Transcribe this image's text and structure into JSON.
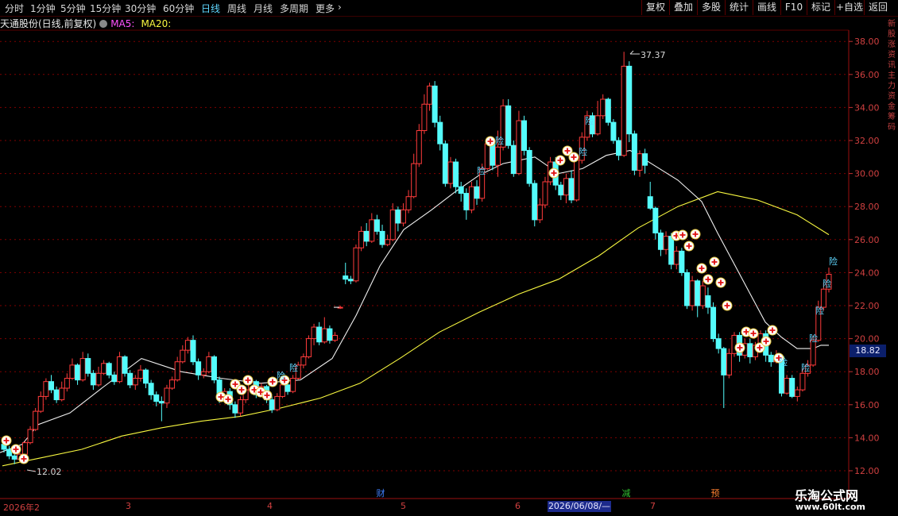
{
  "toolbar": {
    "periods": [
      "分时",
      "1分钟",
      "5分钟",
      "15分钟",
      "30分钟",
      "60分钟",
      "日线",
      "周线",
      "月线",
      "多周期",
      "更多"
    ],
    "active_period": "日线",
    "more_chevron": "›",
    "buttons": [
      "复权",
      "叠加",
      "多股",
      "统计",
      "画线",
      "F10",
      "标记",
      "+自选",
      "返回"
    ]
  },
  "stock": {
    "title": "天通股份(日线,前复权)",
    "ma5_label": "MA5:",
    "ma20_label": "MA20:"
  },
  "colors": {
    "up": "#ff3b3b",
    "down": "#54fcfc",
    "ma5": "#f0f0f0",
    "ma20": "#f8f840",
    "grid": "#800000",
    "axis_text": "#d04040"
  },
  "price_axis": {
    "ticks": [
      "38.00",
      "36.00",
      "34.00",
      "32.00",
      "30.00",
      "28.00",
      "26.00",
      "24.00",
      "22.00",
      "20.00",
      "18.00",
      "16.00",
      "14.00",
      "12.00"
    ]
  },
  "current_price": "18.82",
  "annotations": {
    "high": "37.37",
    "low": "12.02"
  },
  "sidebar_text": "新股涨资讯主力资金筹码",
  "x_axis": {
    "labels": [
      "2026年2",
      "3",
      "4",
      "5",
      "6",
      "7"
    ],
    "cursor_date": "2026/06/08/—"
  },
  "events": {
    "cai": "财",
    "jian": "减",
    "yu": "预"
  },
  "markers": {
    "xian": "险"
  },
  "watermark": {
    "title": "乐淘公式网",
    "url": "www.60lt.com"
  },
  "chart_data": {
    "type": "candlestick",
    "ylim": [
      12,
      38
    ],
    "high_label": 37.37,
    "low_label": 12.02,
    "last": 18.82,
    "candles": [
      [
        13.6,
        13.3,
        13.9,
        13.1
      ],
      [
        13.3,
        12.9,
        13.5,
        12.7
      ],
      [
        12.9,
        12.7,
        13.1,
        12.4
      ],
      [
        12.7,
        13.0,
        13.2,
        12.5
      ],
      [
        13.0,
        13.7,
        13.8,
        12.9
      ],
      [
        13.7,
        14.5,
        14.7,
        13.6
      ],
      [
        14.5,
        15.6,
        15.8,
        14.4
      ],
      [
        15.6,
        16.5,
        16.8,
        15.5
      ],
      [
        16.5,
        17.4,
        17.6,
        16.3
      ],
      [
        17.4,
        16.9,
        17.8,
        16.7
      ],
      [
        16.9,
        16.3,
        17.1,
        16.1
      ],
      [
        16.3,
        17.0,
        17.4,
        16.2
      ],
      [
        17.0,
        17.6,
        17.9,
        16.8
      ],
      [
        17.6,
        18.4,
        18.8,
        17.5
      ],
      [
        18.4,
        17.5,
        18.5,
        17.2
      ],
      [
        17.5,
        18.8,
        19.2,
        17.4
      ],
      [
        18.8,
        17.9,
        19.1,
        17.7
      ],
      [
        17.9,
        17.2,
        18.1,
        16.9
      ],
      [
        17.2,
        17.9,
        18.3,
        17.1
      ],
      [
        17.9,
        18.5,
        18.7,
        17.8
      ],
      [
        18.5,
        17.8,
        18.6,
        17.6
      ],
      [
        17.8,
        17.4,
        18.0,
        17.2
      ],
      [
        17.4,
        18.9,
        19.2,
        17.3
      ],
      [
        18.9,
        17.9,
        19.0,
        17.7
      ],
      [
        17.9,
        17.2,
        18.1,
        17.0
      ],
      [
        17.2,
        17.6,
        17.8,
        16.9
      ],
      [
        17.6,
        18.1,
        18.4,
        17.4
      ],
      [
        18.1,
        17.3,
        18.2,
        17.0
      ],
      [
        17.3,
        16.6,
        17.5,
        16.3
      ],
      [
        16.6,
        16.2,
        16.8,
        15.9
      ],
      [
        16.2,
        16.1,
        16.5,
        15.0
      ],
      [
        16.1,
        17.0,
        17.2,
        15.8
      ],
      [
        17.0,
        17.5,
        17.7,
        16.9
      ],
      [
        17.5,
        18.6,
        18.9,
        17.4
      ],
      [
        18.6,
        19.3,
        19.6,
        18.5
      ],
      [
        19.3,
        19.9,
        20.1,
        19.1
      ],
      [
        19.9,
        18.6,
        20.2,
        18.4
      ],
      [
        18.6,
        17.8,
        18.8,
        17.5
      ],
      [
        17.8,
        18.0,
        18.2,
        17.6
      ],
      [
        18.0,
        18.9,
        19.2,
        17.9
      ],
      [
        18.9,
        17.5,
        19.0,
        17.3
      ],
      [
        17.5,
        16.4,
        17.7,
        16.1
      ],
      [
        16.4,
        16.8,
        17.0,
        16.2
      ],
      [
        16.8,
        16.0,
        17.0,
        15.7
      ],
      [
        16.0,
        15.5,
        16.2,
        15.2
      ],
      [
        15.5,
        16.3,
        16.5,
        15.3
      ],
      [
        16.3,
        16.9,
        17.1,
        16.1
      ],
      [
        16.9,
        17.4,
        17.6,
        16.7
      ],
      [
        17.4,
        16.6,
        17.5,
        16.4
      ],
      [
        16.6,
        17.1,
        17.3,
        16.5
      ],
      [
        17.1,
        16.3,
        17.2,
        16.1
      ],
      [
        16.3,
        15.7,
        16.5,
        15.5
      ],
      [
        15.7,
        16.5,
        16.7,
        15.6
      ],
      [
        16.5,
        17.2,
        17.4,
        16.4
      ],
      [
        17.2,
        16.8,
        17.5,
        16.6
      ],
      [
        16.8,
        17.6,
        17.8,
        16.7
      ],
      [
        17.6,
        18.4,
        18.6,
        17.5
      ],
      [
        18.4,
        18.9,
        19.1,
        18.2
      ],
      [
        18.9,
        20.0,
        20.2,
        18.8
      ],
      [
        20.0,
        20.7,
        20.9,
        19.6
      ],
      [
        20.7,
        19.8,
        21.0,
        19.6
      ],
      [
        19.8,
        20.6,
        21.3,
        19.7
      ],
      [
        20.6,
        19.9,
        20.8,
        19.7
      ],
      [
        19.9,
        20.2,
        20.4,
        19.8
      ],
      [
        21.9,
        21.9,
        22.0,
        21.8
      ],
      [
        23.8,
        23.6,
        24.6,
        23.3
      ],
      [
        23.6,
        23.5,
        23.8,
        23.3
      ],
      [
        23.5,
        25.5,
        25.7,
        23.4
      ],
      [
        25.5,
        26.5,
        26.8,
        25.3
      ],
      [
        26.5,
        25.9,
        27.0,
        25.6
      ],
      [
        25.9,
        27.2,
        27.6,
        25.8
      ],
      [
        27.2,
        26.5,
        27.5,
        26.3
      ],
      [
        26.5,
        25.7,
        26.9,
        25.5
      ],
      [
        25.7,
        26.0,
        26.3,
        25.6
      ],
      [
        26.0,
        27.8,
        28.2,
        25.9
      ],
      [
        27.8,
        27.0,
        28.0,
        26.5
      ],
      [
        27.0,
        27.8,
        28.2,
        26.8
      ],
      [
        27.8,
        28.6,
        29.0,
        27.6
      ],
      [
        28.6,
        30.6,
        31.2,
        28.5
      ],
      [
        30.6,
        32.6,
        33.0,
        30.4
      ],
      [
        32.6,
        34.2,
        34.8,
        32.4
      ],
      [
        34.2,
        35.3,
        35.5,
        33.8
      ],
      [
        35.3,
        33.1,
        35.6,
        32.8
      ],
      [
        33.1,
        31.8,
        33.5,
        31.4
      ],
      [
        31.8,
        29.4,
        32.0,
        29.2
      ],
      [
        29.4,
        30.7,
        31.0,
        29.1
      ],
      [
        30.7,
        29.2,
        30.9,
        28.8
      ],
      [
        29.2,
        28.8,
        29.5,
        28.3
      ],
      [
        28.8,
        27.8,
        29.1,
        27.2
      ],
      [
        27.8,
        29.2,
        29.5,
        27.6
      ],
      [
        29.2,
        28.5,
        29.6,
        28.1
      ],
      [
        28.5,
        30.3,
        30.6,
        28.3
      ],
      [
        30.3,
        31.8,
        32.2,
        30.2
      ],
      [
        31.8,
        30.5,
        32.0,
        30.2
      ],
      [
        30.5,
        31.6,
        32.6,
        29.8
      ],
      [
        31.6,
        34.1,
        34.5,
        31.4
      ],
      [
        34.1,
        31.7,
        34.5,
        31.5
      ],
      [
        31.7,
        30.0,
        32.0,
        29.8
      ],
      [
        30.0,
        33.2,
        33.8,
        29.9
      ],
      [
        33.2,
        31.4,
        33.5,
        31.1
      ],
      [
        31.4,
        29.4,
        31.6,
        29.2
      ],
      [
        29.4,
        27.2,
        29.6,
        26.8
      ],
      [
        27.2,
        28.1,
        28.5,
        27.0
      ],
      [
        28.1,
        29.5,
        29.8,
        27.9
      ],
      [
        29.5,
        30.7,
        31.0,
        29.3
      ],
      [
        30.7,
        29.3,
        31.0,
        29.0
      ],
      [
        29.3,
        28.7,
        29.5,
        28.4
      ],
      [
        28.7,
        29.7,
        30.0,
        28.2
      ],
      [
        29.7,
        28.4,
        30.2,
        28.2
      ],
      [
        28.4,
        30.8,
        31.2,
        28.3
      ],
      [
        30.8,
        32.2,
        32.5,
        30.6
      ],
      [
        32.2,
        33.5,
        33.8,
        32.0
      ],
      [
        33.5,
        32.4,
        33.7,
        32.2
      ],
      [
        32.4,
        33.5,
        34.4,
        32.3
      ],
      [
        33.5,
        34.5,
        34.8,
        33.3
      ],
      [
        34.5,
        33.1,
        34.6,
        32.9
      ],
      [
        33.1,
        32.0,
        33.3,
        31.8
      ],
      [
        32.0,
        31.1,
        32.2,
        30.8
      ],
      [
        31.1,
        36.5,
        37.37,
        31.0
      ],
      [
        36.5,
        32.4,
        36.8,
        31.9
      ],
      [
        32.4,
        30.2,
        32.6,
        29.9
      ],
      [
        30.2,
        31.2,
        31.4,
        29.8
      ],
      [
        31.2,
        30.5,
        31.5,
        30.0
      ],
      [
        28.6,
        27.9,
        29.5,
        27.8
      ],
      [
        27.9,
        26.4,
        28.0,
        26.0
      ],
      [
        26.4,
        25.4,
        26.6,
        25.0
      ],
      [
        25.4,
        26.2,
        26.5,
        25.1
      ],
      [
        26.2,
        24.5,
        26.4,
        24.2
      ],
      [
        24.5,
        25.3,
        25.6,
        24.2
      ],
      [
        25.3,
        24.0,
        25.5,
        23.8
      ],
      [
        24.0,
        22.0,
        24.2,
        21.8
      ],
      [
        22.0,
        23.5,
        23.8,
        21.7
      ],
      [
        23.5,
        22.0,
        23.6,
        21.3
      ],
      [
        22.0,
        23.2,
        23.5,
        21.8
      ],
      [
        22.6,
        21.9,
        23.1,
        21.5
      ],
      [
        21.9,
        20.0,
        22.2,
        19.8
      ],
      [
        20.0,
        19.4,
        20.3,
        19.1
      ],
      [
        19.4,
        17.8,
        19.5,
        15.8
      ],
      [
        17.8,
        19.1,
        19.4,
        17.6
      ],
      [
        19.1,
        20.2,
        20.4,
        18.9
      ],
      [
        20.2,
        19.0,
        20.4,
        18.6
      ],
      [
        19.0,
        19.7,
        20.0,
        18.8
      ],
      [
        19.7,
        18.9,
        20.0,
        18.5
      ],
      [
        18.9,
        19.6,
        19.8,
        18.7
      ],
      [
        19.6,
        20.3,
        20.5,
        19.4
      ],
      [
        20.3,
        19.0,
        20.5,
        18.6
      ],
      [
        19.0,
        18.6,
        19.2,
        18.3
      ],
      [
        18.6,
        18.9,
        19.3,
        18.5
      ],
      [
        18.9,
        16.7,
        19.0,
        16.5
      ],
      [
        16.7,
        17.6,
        17.8,
        16.6
      ],
      [
        17.6,
        16.5,
        17.8,
        16.4
      ],
      [
        16.5,
        16.9,
        17.1,
        16.2
      ],
      [
        16.9,
        17.9,
        18.2,
        16.8
      ],
      [
        17.9,
        18.4,
        18.7,
        17.7
      ],
      [
        18.4,
        19.9,
        20.2,
        18.3
      ],
      [
        19.9,
        21.9,
        22.3,
        19.8
      ],
      [
        21.9,
        23.0,
        23.4,
        21.7
      ],
      [
        23.0,
        23.9,
        24.3,
        22.8
      ]
    ],
    "ma5": [
      [
        0,
        13.1
      ],
      [
        28,
        13.6
      ],
      [
        48,
        14.8
      ],
      [
        88,
        15.5
      ],
      [
        128,
        17.0
      ],
      [
        178,
        18.8
      ],
      [
        228,
        18.0
      ],
      [
        278,
        17.6
      ],
      [
        328,
        17.3
      ],
      [
        378,
        17.5
      ],
      [
        418,
        18.8
      ],
      [
        448,
        21.4
      ],
      [
        478,
        24.4
      ],
      [
        508,
        26.6
      ],
      [
        543,
        27.8
      ],
      [
        573,
        28.9
      ],
      [
        603,
        29.9
      ],
      [
        633,
        30.6
      ],
      [
        673,
        31.0
      ],
      [
        703,
        30.0
      ],
      [
        733,
        30.3
      ],
      [
        763,
        31.1
      ],
      [
        793,
        31.4
      ],
      [
        823,
        30.5
      ],
      [
        853,
        29.6
      ],
      [
        883,
        28.3
      ],
      [
        903,
        26.4
      ],
      [
        923,
        24.6
      ],
      [
        943,
        22.8
      ],
      [
        963,
        21.0
      ],
      [
        983,
        20.1
      ],
      [
        1003,
        19.4
      ],
      [
        1023,
        19.4
      ],
      [
        1033,
        19.6
      ],
      [
        1043,
        19.6
      ]
    ],
    "ma20": [
      [
        3,
        12.3
      ],
      [
        53,
        12.8
      ],
      [
        103,
        13.3
      ],
      [
        153,
        14.1
      ],
      [
        203,
        14.6
      ],
      [
        253,
        15.0
      ],
      [
        303,
        15.3
      ],
      [
        353,
        15.8
      ],
      [
        403,
        16.4
      ],
      [
        453,
        17.3
      ],
      [
        503,
        18.8
      ],
      [
        553,
        20.4
      ],
      [
        603,
        21.6
      ],
      [
        653,
        22.7
      ],
      [
        703,
        23.6
      ],
      [
        753,
        25.0
      ],
      [
        803,
        26.7
      ],
      [
        853,
        28.0
      ],
      [
        903,
        28.9
      ],
      [
        953,
        28.4
      ],
      [
        1003,
        27.5
      ],
      [
        1043,
        26.3
      ]
    ]
  }
}
